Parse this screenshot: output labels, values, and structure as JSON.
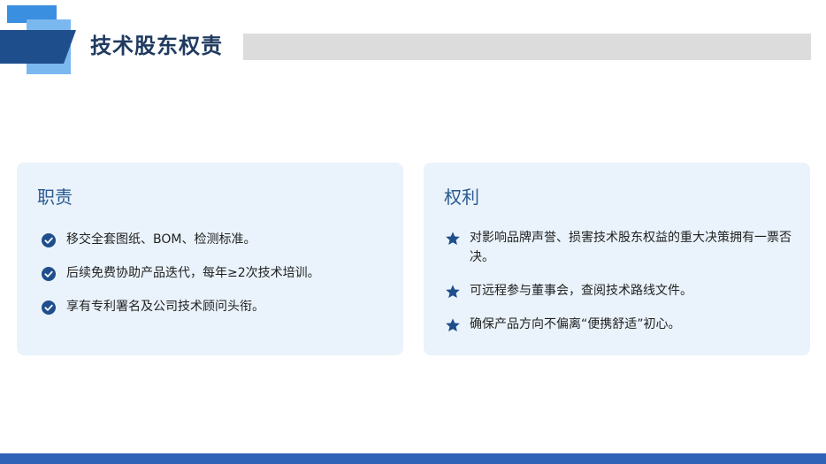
{
  "header": {
    "title": "技术股东权责"
  },
  "cards": {
    "duties": {
      "title": "职责",
      "items": [
        "移交全套图纸、BOM、检测标准。",
        "后续免费协助产品迭代，每年≥2次技术培训。",
        "享有专利署名及公司技术顾问头衔。"
      ]
    },
    "rights": {
      "title": "权利",
      "items": [
        "对影响品牌声誉、损害技术股东权益的重大决策拥有一票否决。",
        "可远程参与董事会，查阅技术路线文件。",
        "确保产品方向不偏离“便携舒适”初心。"
      ]
    }
  },
  "colors": {
    "title": "#1f3a5f",
    "card_bg": "#eaf3fc",
    "accent": "#2a5a8f",
    "icon": "#1f4e8c",
    "bottom_bar": "#2f63b8"
  },
  "icons": {
    "duty_bullet": "check-circle-icon",
    "right_bullet": "star-icon"
  }
}
